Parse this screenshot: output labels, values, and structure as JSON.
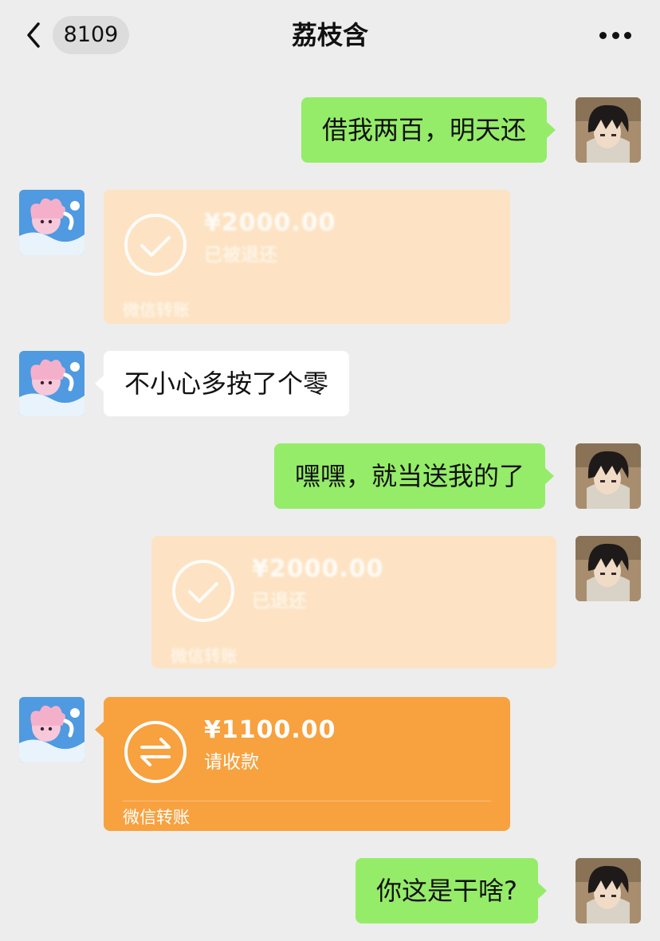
{
  "header": {
    "unread_count": "8109",
    "contact_name": "荔枝含",
    "back_icon": "chevron-left-icon",
    "more_icon": "more-dots-icon"
  },
  "colors": {
    "background": "#ededed",
    "sent_bubble": "#95ec69",
    "received_bubble": "#ffffff",
    "transfer_active": "#f8a13f",
    "transfer_done": "#fde3c3"
  },
  "messages": [
    {
      "from": "me",
      "type": "text",
      "text": "借我两百，明天还"
    },
    {
      "from": "them",
      "type": "transfer",
      "amount": "¥2000.00",
      "status": "已被退还",
      "footer": "微信转账",
      "state": "completed"
    },
    {
      "from": "them",
      "type": "text",
      "text": "不小心多按了个零"
    },
    {
      "from": "me",
      "type": "text",
      "text": "嘿嘿，就当送我的了"
    },
    {
      "from": "me",
      "type": "transfer",
      "amount": "¥2000.00",
      "status": "已退还",
      "footer": "微信转账",
      "state": "completed"
    },
    {
      "from": "them",
      "type": "transfer",
      "amount": "¥1100.00",
      "status": "请收款",
      "footer": "微信转账",
      "state": "pending"
    },
    {
      "from": "me",
      "type": "text",
      "text": "你这是干啥?"
    }
  ]
}
